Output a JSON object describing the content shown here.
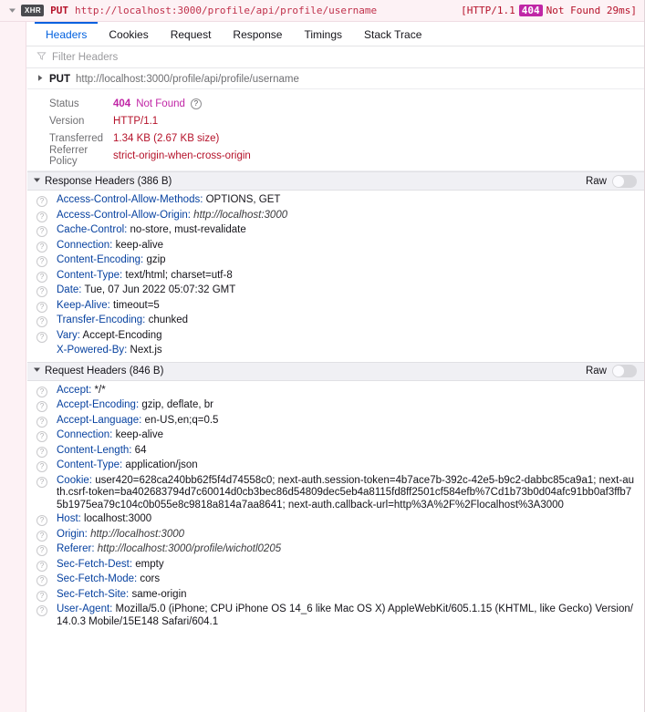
{
  "request_bar": {
    "twisty_icon": "triangle-down-icon",
    "type_badge": "XHR",
    "method": "PUT",
    "url": "http://localhost:3000/profile/api/profile/username",
    "status_prefix": "[HTTP/1.1",
    "status_code": "404",
    "status_text": "Not Found 29ms]"
  },
  "tabs": [
    {
      "label": "Headers",
      "active": true
    },
    {
      "label": "Cookies",
      "active": false
    },
    {
      "label": "Request",
      "active": false
    },
    {
      "label": "Response",
      "active": false
    },
    {
      "label": "Timings",
      "active": false
    },
    {
      "label": "Stack Trace",
      "active": false
    }
  ],
  "filter": {
    "icon": "filter-funnel-icon",
    "placeholder": "Filter Headers",
    "value": ""
  },
  "url_summary": {
    "twisty_icon": "triangle-right-icon",
    "method": "PUT",
    "url": "http://localhost:3000/profile/api/profile/username"
  },
  "status_block": {
    "status_label": "Status",
    "status_code": "404",
    "status_phrase": "Not Found",
    "status_help_icon": "question-mark-icon",
    "version_label": "Version",
    "version_value": "HTTP/1.1",
    "transferred_label": "Transferred",
    "transferred_value": "1.34 KB (2.67 KB size)",
    "referrer_label": "Referrer Policy",
    "referrer_value": "strict-origin-when-cross-origin"
  },
  "response_section": {
    "twisty_icon": "triangle-down-icon",
    "title": "Response Headers (386 B)",
    "raw_label": "Raw",
    "raw_enabled": false,
    "headers": [
      {
        "name": "Access-Control-Allow-Methods:",
        "value": "OPTIONS, GET",
        "italic": false,
        "help": true
      },
      {
        "name": "Access-Control-Allow-Origin:",
        "value": "http://localhost:3000",
        "italic": true,
        "help": true
      },
      {
        "name": "Cache-Control:",
        "value": "no-store, must-revalidate",
        "italic": false,
        "help": true
      },
      {
        "name": "Connection:",
        "value": "keep-alive",
        "italic": false,
        "help": true
      },
      {
        "name": "Content-Encoding:",
        "value": "gzip",
        "italic": false,
        "help": true
      },
      {
        "name": "Content-Type:",
        "value": "text/html; charset=utf-8",
        "italic": false,
        "help": true
      },
      {
        "name": "Date:",
        "value": "Tue, 07 Jun 2022 05:07:32 GMT",
        "italic": false,
        "help": true
      },
      {
        "name": "Keep-Alive:",
        "value": "timeout=5",
        "italic": false,
        "help": true
      },
      {
        "name": "Transfer-Encoding:",
        "value": "chunked",
        "italic": false,
        "help": true
      },
      {
        "name": "Vary:",
        "value": "Accept-Encoding",
        "italic": false,
        "help": true
      },
      {
        "name": "X-Powered-By:",
        "value": "Next.js",
        "italic": false,
        "help": false
      }
    ]
  },
  "request_section": {
    "twisty_icon": "triangle-down-icon",
    "title": "Request Headers (846 B)",
    "raw_label": "Raw",
    "raw_enabled": false,
    "headers": [
      {
        "name": "Accept:",
        "value": "*/*",
        "italic": false,
        "help": true
      },
      {
        "name": "Accept-Encoding:",
        "value": "gzip, deflate, br",
        "italic": false,
        "help": true
      },
      {
        "name": "Accept-Language:",
        "value": "en-US,en;q=0.5",
        "italic": false,
        "help": true
      },
      {
        "name": "Connection:",
        "value": "keep-alive",
        "italic": false,
        "help": true
      },
      {
        "name": "Content-Length:",
        "value": "64",
        "italic": false,
        "help": true
      },
      {
        "name": "Content-Type:",
        "value": "application/json",
        "italic": false,
        "help": true
      },
      {
        "name": "Cookie:",
        "value": "user420=628ca240bb62f5f4d74558c0; next-auth.session-token=4b7ace7b-392c-42e5-b9c2-dabbc85ca9a1; next-auth.csrf-token=ba402683794d7c60014d0cb3bec86d54809dec5eb4a8115fd8ff2501cf584efb%7Cd1b73b0d04afc91bb0af3ffb75b1975ea79c104c0b055e8c9818a814a7aa8641; next-auth.callback-url=http%3A%2F%2Flocalhost%3A3000",
        "italic": false,
        "help": true
      },
      {
        "name": "Host:",
        "value": "localhost:3000",
        "italic": false,
        "help": true
      },
      {
        "name": "Origin:",
        "value": "http://localhost:3000",
        "italic": true,
        "help": true
      },
      {
        "name": "Referer:",
        "value": "http://localhost:3000/profile/wichotl0205",
        "italic": true,
        "help": true
      },
      {
        "name": "Sec-Fetch-Dest:",
        "value": "empty",
        "italic": false,
        "help": true
      },
      {
        "name": "Sec-Fetch-Mode:",
        "value": "cors",
        "italic": false,
        "help": true
      },
      {
        "name": "Sec-Fetch-Site:",
        "value": "same-origin",
        "italic": false,
        "help": true
      },
      {
        "name": "User-Agent:",
        "value": "Mozilla/5.0 (iPhone; CPU iPhone OS 14_6 like Mac OS X) AppleWebKit/605.1.15 (KHTML, like Gecko) Version/14.0.3 Mobile/15E148 Safari/604.1",
        "italic": false,
        "help": true
      }
    ]
  },
  "colors": {
    "accent_blue": "#0060df",
    "header_name_blue": "#0842a0",
    "status_magenta": "#c026a6",
    "url_red": "#c0314b",
    "bar_bg": "#fdf2f5"
  }
}
